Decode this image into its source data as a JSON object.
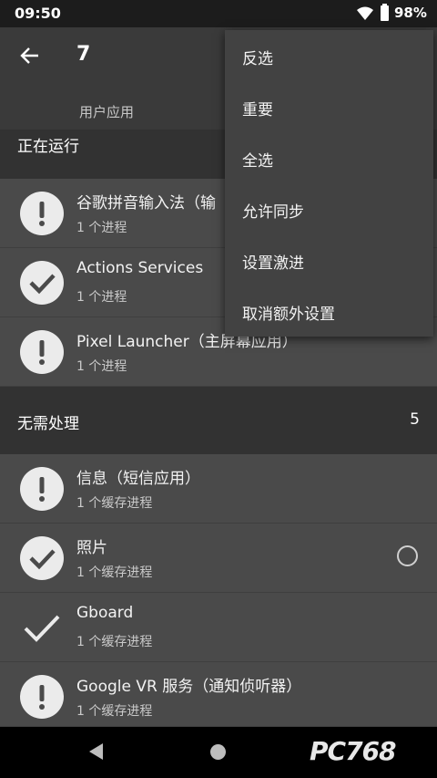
{
  "status_bar": {
    "time": "09:50",
    "battery": "98%"
  },
  "app_bar": {
    "title": "7"
  },
  "tabs": {
    "tab1": "用户应用"
  },
  "section_running": {
    "title": "正在运行"
  },
  "running_items": [
    {
      "title": "谷歌拼音输入法（输",
      "sub": "1 个进程",
      "icon": "exclamation-icon"
    },
    {
      "title": "Actions Services",
      "sub": "1 个进程",
      "icon": "check-icon"
    },
    {
      "title": "Pixel Launcher（主屏幕应用）",
      "sub": "1 个进程",
      "icon": "exclamation-icon"
    }
  ],
  "section_idle": {
    "title": "无需处理",
    "count": "5"
  },
  "idle_items": [
    {
      "title": "信息（短信应用）",
      "sub": "1 个缓存进程",
      "icon": "exclamation-icon"
    },
    {
      "title": "照片",
      "sub": "1 个缓存进程",
      "icon": "check-icon"
    },
    {
      "title": "Gboard",
      "sub": "1 个缓存进程",
      "icon": "check-mark-icon"
    },
    {
      "title": "Google VR 服务（通知侦听器）",
      "sub": "1 个缓存进程",
      "icon": "exclamation-icon"
    }
  ],
  "menu": {
    "items": [
      "反选",
      "重要",
      "全选",
      "允许同步",
      "设置激进",
      "取消额外设置"
    ]
  },
  "watermark": "PC768",
  "colors": {
    "accent": "#2b9ad8",
    "menu_bg": "#424242",
    "item_bg": "#4a4a4a"
  }
}
